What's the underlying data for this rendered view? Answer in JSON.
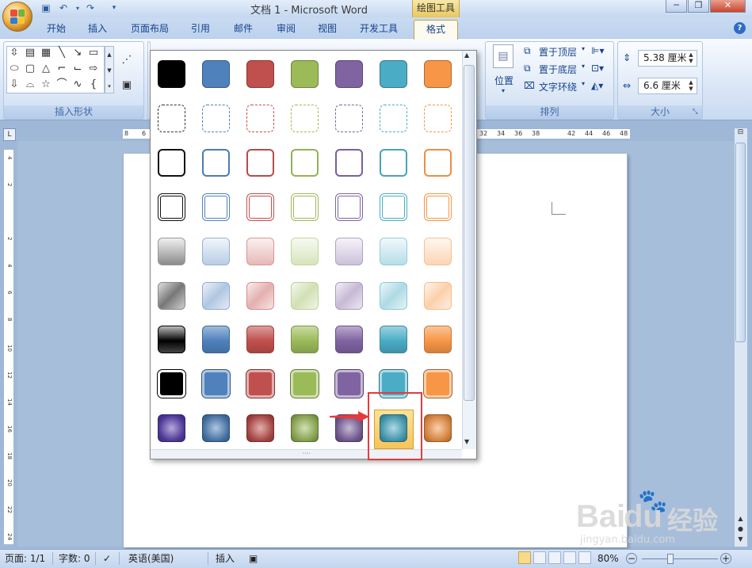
{
  "titlebar": {
    "title": "文档 1 - Microsoft Word",
    "context_tab_title": "绘图工具",
    "qat": [
      "save-icon",
      "undo-icon",
      "dropdown-icon",
      "redo-icon",
      "customize-qat-icon"
    ]
  },
  "tabs": [
    "开始",
    "插入",
    "页面布局",
    "引用",
    "邮件",
    "审阅",
    "视图",
    "开发工具"
  ],
  "active_tab": "格式",
  "ribbon": {
    "insert_shapes_label": "插入形状",
    "arrange_label": "排列",
    "size_label": "大小",
    "position_label": "位置",
    "bring_front": "置于顶层",
    "send_back": "置于底层",
    "text_wrap": "文字环绕",
    "height_value": "5.38 厘米",
    "width_value": "6.6 厘米"
  },
  "ruler": {
    "h_ticks_left": [
      "8",
      "6"
    ],
    "h_ticks_right": [
      "32",
      "34",
      "36",
      "38",
      "",
      "42",
      "44",
      "46",
      "48"
    ],
    "v_ticks": [
      "4",
      "2",
      "",
      "2",
      "4",
      "6",
      "8",
      "10",
      "12",
      "14",
      "16",
      "18",
      "20",
      "22",
      "24"
    ]
  },
  "gallery": {
    "colors": [
      "#000000",
      "#4f81bd",
      "#c0504d",
      "#9bbb59",
      "#8064a2",
      "#4bacc6",
      "#f79646"
    ],
    "row_styles": [
      "solid",
      "dashed",
      "outline",
      "double",
      "light-gradient",
      "medium-gradient",
      "strong-gradient",
      "solid-bordered",
      "glow"
    ],
    "selected_row": 8,
    "selected_col": 5
  },
  "statusbar": {
    "page": "页面: 1/1",
    "words": "字数: 0",
    "language": "英语(美国)",
    "mode": "插入",
    "zoom": "80%"
  },
  "watermark": {
    "brand": "Bai",
    "brand2": "du",
    "cn": "经验",
    "url": "jingyan.baidu.com"
  }
}
